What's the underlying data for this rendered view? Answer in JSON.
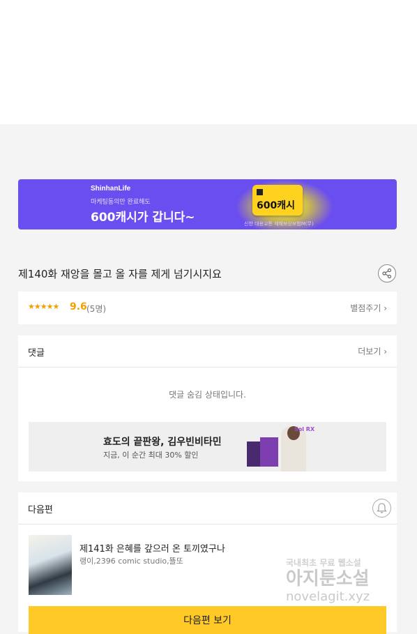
{
  "banner": {
    "brand": "ShinhanLife",
    "subline": "마케팅동의만 완료해도",
    "headline": "600캐시가 갑니다~",
    "cash_card": "600캐시",
    "footnote": "신한 대용교통 재해보상보험M(무)"
  },
  "episode": {
    "title": "제140화 재앙을 몰고 올 자를 제게 넘기시지요",
    "stars": "★★★★★",
    "score": "9.6",
    "count": "(5명)",
    "rate_link": "별점주기 ›"
  },
  "comments": {
    "title": "댓글",
    "more": "더보기 ›",
    "hidden_message": "댓글 숨김 상태입니다."
  },
  "ad": {
    "title": "효도의 끝판왕, 김우빈비타민",
    "subtitle": "지금, 이 순간 최대 30% 할인",
    "logo": "Sol RX"
  },
  "next_episode": {
    "section_title": "다음편",
    "title": "제141화 은혜를 갚으러 온 토끼였구나",
    "authors": "랭이,2396 comic studio,뚈또",
    "button": "다음편 보기"
  },
  "watermark": {
    "line1": "국내최초 무료 웹소설",
    "line2": "아지툰소설",
    "line3": "novelagit.xyz"
  }
}
